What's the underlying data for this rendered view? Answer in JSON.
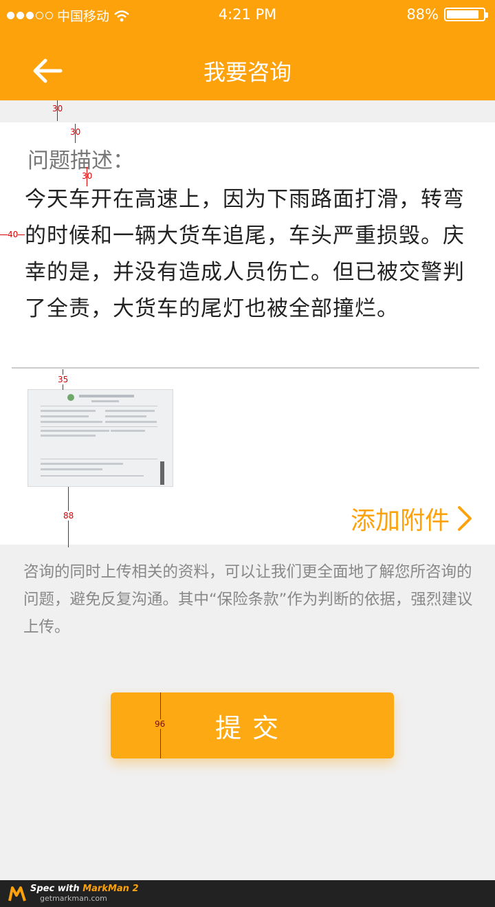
{
  "status_bar": {
    "carrier": "中国移动",
    "time": "4:21 PM",
    "battery": "88%",
    "battery_level": 0.88
  },
  "nav": {
    "title": "我要咨询"
  },
  "question": {
    "label": "问题描述：",
    "body": "今天车开在高速上，因为下雨路面打滑，转弯的时候和一辆大货车追尾，车头严重损毁。庆幸的是，并没有造成人员伤亡。但已被交警判了全责，大货车的尾灯也被全部撞烂。"
  },
  "attachment": {
    "add_label": "添加附件"
  },
  "hint": {
    "text": "咨询的同时上传相关的资料，可以让我们更全面地了解您所咨询的问题，避免反复沟通。其中“保险条款”作为判断的依据，强烈建议上传。"
  },
  "submit": {
    "label": "提交"
  },
  "annotations": {
    "a1": "30",
    "a2": "30",
    "a3": "30",
    "a4": "40",
    "a5": "35",
    "a6": "88",
    "a7": "96"
  },
  "footer": {
    "line1": "Spec with ",
    "brand": "MarkMan 2",
    "line2": "getmarkman.com"
  },
  "colors": {
    "accent": "#fda20b",
    "background": "#f0f0f0"
  }
}
